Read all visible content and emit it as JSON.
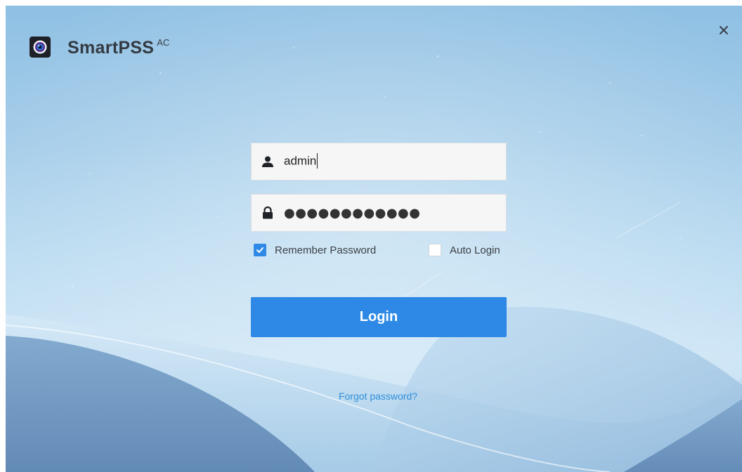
{
  "app": {
    "name": "SmartPSS",
    "superscript": "AC",
    "logo_icon": "camera-lens-icon",
    "close_icon": "close-icon"
  },
  "login_form": {
    "username": {
      "icon": "user-icon",
      "value": "admin"
    },
    "password": {
      "icon": "lock-icon",
      "masked_value": "●●●●●●●●●●●●"
    },
    "remember_password": {
      "label": "Remember Password",
      "checked": true
    },
    "auto_login": {
      "label": "Auto Login",
      "checked": false
    },
    "login_button_label": "Login",
    "forgot_password_label": "Forgot password?"
  },
  "colors": {
    "accent": "#2e89e6",
    "link": "#2f8fdc",
    "background_top": "#8fc0e3",
    "background_bottom": "#cfe6f6"
  }
}
